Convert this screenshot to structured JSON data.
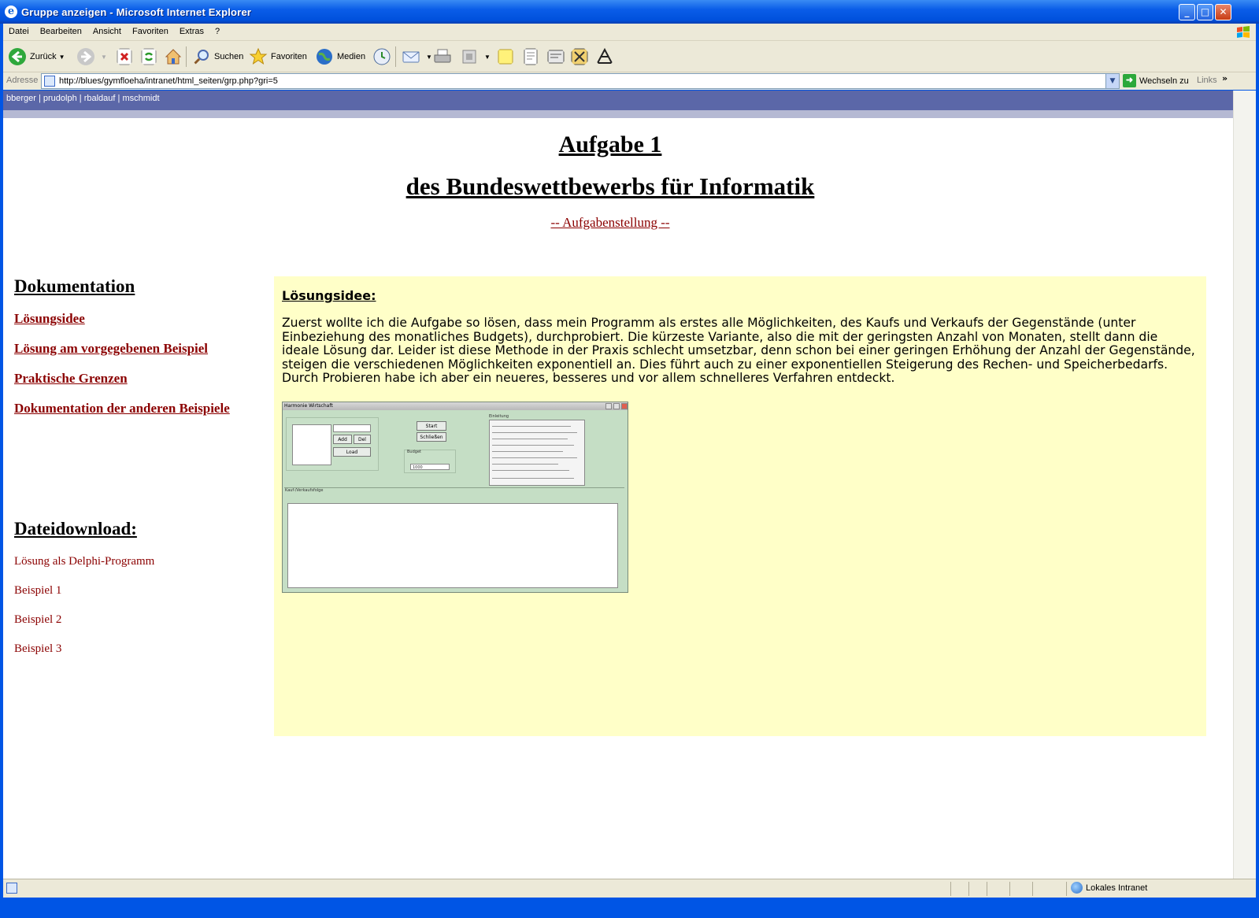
{
  "window": {
    "title": "Gruppe anzeigen - Microsoft Internet Explorer",
    "controls": {
      "minimize": "_",
      "maximize": "□",
      "close": "✕"
    }
  },
  "menu": [
    "Datei",
    "Bearbeiten",
    "Ansicht",
    "Favoriten",
    "Extras",
    "?"
  ],
  "toolbar": {
    "back_label": "Zurück",
    "search_label": "Suchen",
    "favorites_label": "Favoriten",
    "media_label": "Medien"
  },
  "address": {
    "label": "Adresse",
    "url": "http://blues/gymfloeha/intranet/html_seiten/grp.php?gri=5",
    "go_label": "Wechseln zu",
    "links_label": "Links"
  },
  "page": {
    "users": [
      "bberger",
      "prudolph",
      "rbaldauf",
      "mschmidt"
    ],
    "heading1": "Aufgabe 1",
    "heading2": "des Bundeswettbewerbs für Informatik",
    "task_link": "-- Aufgabenstellung --",
    "sidebar": {
      "doc_heading": "Dokumentation",
      "doc_links": [
        "Lösungsidee",
        "Lösung am vorgegebenen Beispiel",
        "Praktische Grenzen",
        "Dokumentation der anderen Beispiele"
      ],
      "download_heading": "Dateidownload:",
      "download_links": [
        "Lösung als Delphi-Programm",
        "Beispiel 1",
        "Beispiel 2",
        "Beispiel 3"
      ]
    },
    "content": {
      "heading": "Lösungsidee:",
      "paragraph": "Zuerst wollte ich die Aufgabe so lösen, dass mein Programm als erstes alle Möglichkeiten, des Kaufs und Verkaufs der Gegenstände (unter Einbeziehung des monatliches Budgets), durchprobiert. Die kürzeste Variante, also die mit der geringsten Anzahl von Monaten, stellt dann die ideale Lösung dar. Leider ist diese Methode in der Praxis schlecht umsetzbar, denn schon bei einer geringen Erhöhung der Anzahl der Gegenstände, steigen die verschiedenen Möglichkeiten exponentiell an. Dies führt auch zu einer exponentiellen Steigerung des Rechen- und Speicherbedarfs. Durch Probieren habe ich aber ein neueres, besseres und vor allem schnelleres Verfahren entdeckt.",
      "screenshot": {
        "title": "Harmonie Wirtschaft",
        "add_btn": "Add",
        "del_btn": "Del",
        "load_btn": "Load",
        "start_btn": "Start",
        "stop_btn": "Schließen",
        "budget_label": "Budget",
        "budget_value": "1000",
        "help_label": "Einleitung",
        "list_label": "Kauf-/Verkaufsfolge"
      }
    }
  },
  "status": {
    "zone": "Lokales Intranet"
  },
  "colors": {
    "link": "#8b0000",
    "user_bar": "#5b67a8",
    "content_bg": "#ffffc8"
  }
}
